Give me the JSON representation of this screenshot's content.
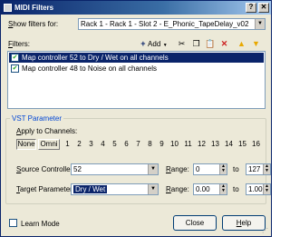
{
  "window": {
    "title": "MIDI Filters",
    "close_glyph": "✕",
    "help_glyph": "?"
  },
  "filters_for": {
    "label_u": "S",
    "label_rest": "how filters for:",
    "value": "Rack 1 - Rack 1 - Slot 2 - E_Phonic_TapeDelay_v02"
  },
  "filters": {
    "label_u": "F",
    "label_rest": "ilters:",
    "add_label": "Add",
    "add_symbol": "+",
    "items": [
      {
        "text": "Map controller 52 to Dry / Wet on all channels",
        "checked": true,
        "selected": true
      },
      {
        "text": "Map controller 48 to Noise on all channels",
        "checked": true,
        "selected": false
      }
    ]
  },
  "toolbar_icons": [
    "scissors-icon",
    "copy-icon",
    "paste-icon",
    "delete-icon",
    "move-up-icon",
    "move-down-icon"
  ],
  "vst": {
    "title": "VST Parameter",
    "apply_label_u": "A",
    "apply_label_rest": "pply to Channels:",
    "none_label": "None",
    "omni_label": "Omni",
    "channels": [
      "1",
      "2",
      "3",
      "4",
      "5",
      "6",
      "7",
      "8",
      "9",
      "10",
      "11",
      "12",
      "13",
      "14",
      "15",
      "16"
    ],
    "source_label_u": "S",
    "source_label_rest": "ource Controller:",
    "source_value": "52",
    "target_label_u": "T",
    "target_label_rest": "arget Parameter:",
    "target_value": "Dry / Wet",
    "range_label_u": "R",
    "range_label_rest": "ange:",
    "range1_from": "0",
    "range1_to": "127",
    "range2_from": "0.00",
    "range2_to": "1.00",
    "to_label": "to"
  },
  "footer": {
    "learn_mode": "Learn Mode",
    "close": "Close",
    "help_u": "H",
    "help_rest": "elp"
  },
  "colors": {
    "selection": "#0a246a",
    "group_title": "#0046d5",
    "icon_red": "#cc2222",
    "icon_yellow": "#e8a800"
  }
}
